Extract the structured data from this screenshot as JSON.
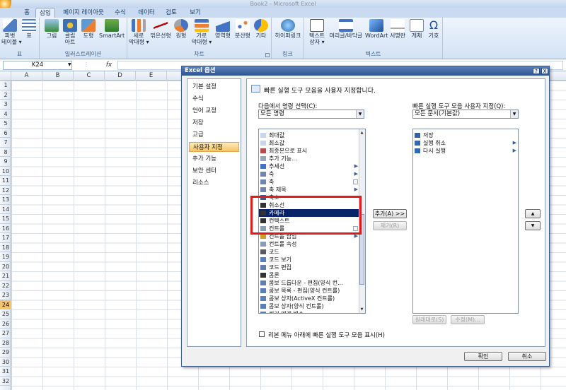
{
  "window": {
    "title": "Book2 - Microsoft Excel"
  },
  "tabs": [
    "홈",
    "삽입",
    "페이지 레이아웃",
    "수식",
    "데이터",
    "검토",
    "보기"
  ],
  "ribbon": {
    "groups": [
      {
        "label": "표",
        "buttons": [
          "피벗\n테이블 ▾",
          "표"
        ]
      },
      {
        "label": "일러스트레이션",
        "buttons": [
          "그림",
          "클립\n아트",
          "도형",
          "SmartArt"
        ]
      },
      {
        "label": "차트",
        "buttons": [
          "세로\n막대형 ▾",
          "꺾은선형",
          "원형",
          "가로\n막대형 ▾",
          "영역형",
          "분산형",
          "기타"
        ]
      },
      {
        "label": "링크",
        "buttons": [
          "하이퍼링크"
        ]
      },
      {
        "label": "텍스트",
        "buttons": [
          "텍스트\n상자 ▾",
          "머리글/바닥글",
          "WordArt",
          "서명란",
          "개체",
          "기호"
        ]
      }
    ]
  },
  "formula_bar": {
    "name_box": "K24",
    "fx": "fx",
    "formula": ""
  },
  "columns": [
    "A",
    "B",
    "C",
    "D",
    "E"
  ],
  "rows": [
    "1",
    "2",
    "3",
    "4",
    "5",
    "6",
    "7",
    "8",
    "9",
    "10",
    "11",
    "12",
    "13",
    "14",
    "15",
    "16",
    "17",
    "18",
    "19",
    "20",
    "21",
    "22",
    "23",
    "24",
    "25",
    "26",
    "27",
    "28",
    "29",
    "30",
    "31",
    "32"
  ],
  "selected_row": "24",
  "dialog": {
    "title": "Excel 옵션",
    "help_btn": "?",
    "close_btn": "X",
    "nav": [
      "기본 설정",
      "수식",
      "언어 교정",
      "저장",
      "고급",
      "사용자 지정",
      "추가 기능",
      "보안 센터",
      "리소스"
    ],
    "nav_active": "사용자 지정",
    "heading": "빠른 실행 도구 모음을 사용자 지정합니다.",
    "choose_label": "다음에서 명령 선택(C):",
    "choose_value": "모든 명령",
    "customize_label": "빠른 실행 도구 모음 사용자 지정(Q):",
    "customize_value": "모든 문서(기본값)",
    "commands": [
      {
        "t": "최대값",
        "m": ""
      },
      {
        "t": "최소값",
        "m": ""
      },
      {
        "t": "최종본으로 표시",
        "m": ""
      },
      {
        "t": "추가 기능...",
        "m": ""
      },
      {
        "t": "추세선",
        "m": ">"
      },
      {
        "t": "축",
        "m": ">"
      },
      {
        "t": "축",
        "m": "dd"
      },
      {
        "t": "축 제목",
        "m": ">"
      },
      {
        "t": "축소",
        "m": ""
      },
      {
        "t": "취소선",
        "m": ""
      },
      {
        "t": "카메라",
        "m": ""
      },
      {
        "t": "컨텍스트",
        "m": ""
      },
      {
        "t": "컨트롤",
        "m": "dd"
      },
      {
        "t": "컨트롤 삽입",
        "m": ">"
      },
      {
        "t": "컨트롤 속성",
        "m": ""
      },
      {
        "t": "코드",
        "m": ""
      },
      {
        "t": "코드 보기",
        "m": ""
      },
      {
        "t": "코드 편집",
        "m": ""
      },
      {
        "t": "콤론",
        "m": ""
      },
      {
        "t": "콤보 드롭다운 - 편집(양식 컨...",
        "m": ""
      },
      {
        "t": "콤보 목록 - 편집(양식 컨트롤)",
        "m": ""
      },
      {
        "t": "콤보 상자(ActiveX 컨트롤)",
        "m": ""
      },
      {
        "t": "콤보 상자(양식 컨트롤)",
        "m": ""
      },
      {
        "t": "쿼리 매개 변수",
        "m": ""
      }
    ],
    "selected_command": "카메라",
    "qat": [
      {
        "t": "저장",
        "m": ""
      },
      {
        "t": "실행 취소",
        "m": ">"
      },
      {
        "t": "다시 실행",
        "m": ">"
      }
    ],
    "add_btn": "추가(A) >>",
    "remove_btn": "제거(R)",
    "up_btn": "▲",
    "down_btn": "▼",
    "reset_btn": "원래대로(S)",
    "modify_btn": "수정(M)...",
    "show_below": "리본 메뉴 아래에 빠른 실행 도구 모음 표시(H)",
    "ok_btn": "확인",
    "cancel_btn": "취소"
  }
}
